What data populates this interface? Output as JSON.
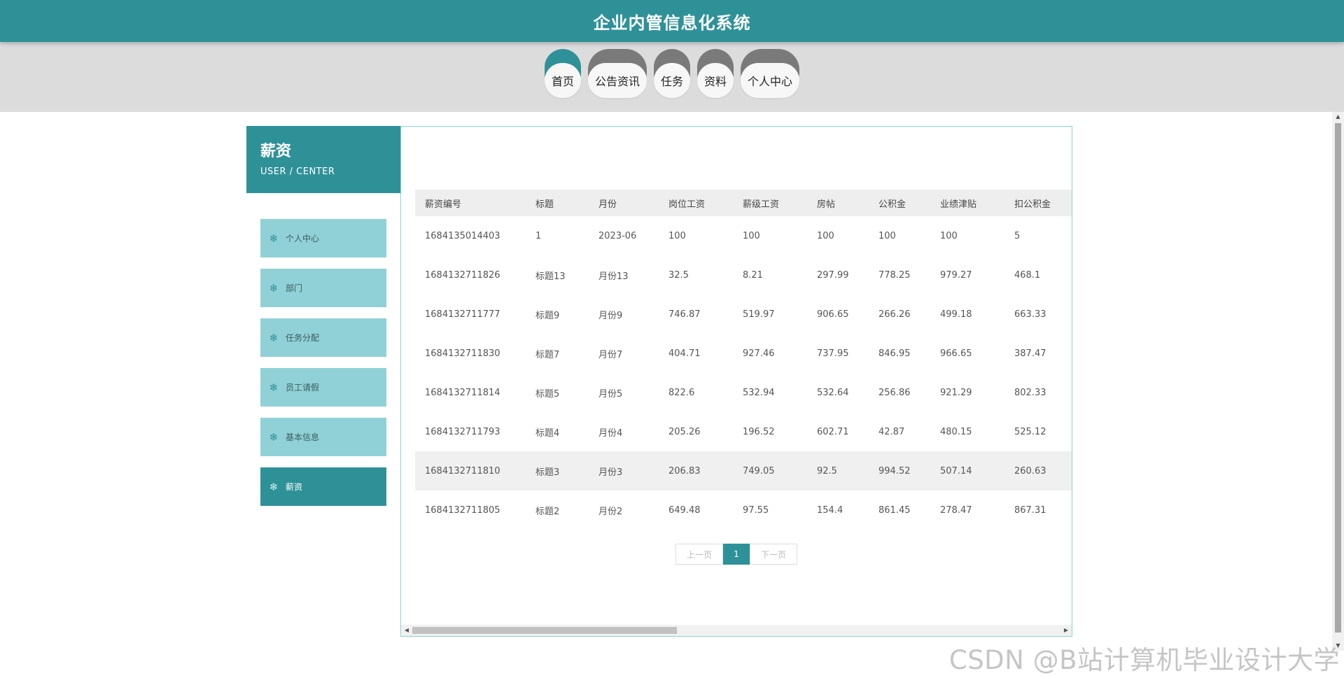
{
  "header": {
    "title": "企业内管信息化系统"
  },
  "nav": {
    "items": [
      "首页",
      "公告资讯",
      "任务",
      "资料",
      "个人中心"
    ],
    "active_index": 0
  },
  "sidebar": {
    "title": "薪资",
    "subtitle": "USER / CENTER",
    "items": [
      {
        "label": "个人中心",
        "active": false
      },
      {
        "label": "部门",
        "active": false
      },
      {
        "label": "任务分配",
        "active": false
      },
      {
        "label": "员工请假",
        "active": false
      },
      {
        "label": "基本信息",
        "active": false
      },
      {
        "label": "薪资",
        "active": true
      }
    ],
    "icon": "snowflake-icon"
  },
  "table": {
    "columns": [
      "薪资编号",
      "标题",
      "月份",
      "岗位工资",
      "薪级工资",
      "房帖",
      "公积金",
      "业绩津贴",
      "扣公积金"
    ],
    "rows": [
      [
        "1684135014403",
        "1",
        "2023-06",
        "100",
        "100",
        "100",
        "100",
        "100",
        "5"
      ],
      [
        "1684132711826",
        "标题13",
        "月份13",
        "32.5",
        "8.21",
        "297.99",
        "778.25",
        "979.27",
        "468.1"
      ],
      [
        "1684132711777",
        "标题9",
        "月份9",
        "746.87",
        "519.97",
        "906.65",
        "266.26",
        "499.18",
        "663.33"
      ],
      [
        "1684132711830",
        "标题7",
        "月份7",
        "404.71",
        "927.46",
        "737.95",
        "846.95",
        "966.65",
        "387.47"
      ],
      [
        "1684132711814",
        "标题5",
        "月份5",
        "822.6",
        "532.94",
        "532.64",
        "256.86",
        "921.29",
        "802.33"
      ],
      [
        "1684132711793",
        "标题4",
        "月份4",
        "205.26",
        "196.52",
        "602.71",
        "42.87",
        "480.15",
        "525.12"
      ],
      [
        "1684132711810",
        "标题3",
        "月份3",
        "206.83",
        "749.05",
        "92.5",
        "994.52",
        "507.14",
        "260.63"
      ],
      [
        "1684132711805",
        "标题2",
        "月份2",
        "649.48",
        "97.55",
        "154.4",
        "861.45",
        "278.47",
        "867.31"
      ]
    ],
    "highlight_row": 6
  },
  "pager": {
    "prev": "上一页",
    "current": "1",
    "next": "下一页"
  },
  "watermark": "CSDN @B站计算机毕业设计大学",
  "colors": {
    "primary": "#2f9198",
    "menu_bg": "#8fd1d6",
    "nav_inactive": "#7a7a7a"
  }
}
